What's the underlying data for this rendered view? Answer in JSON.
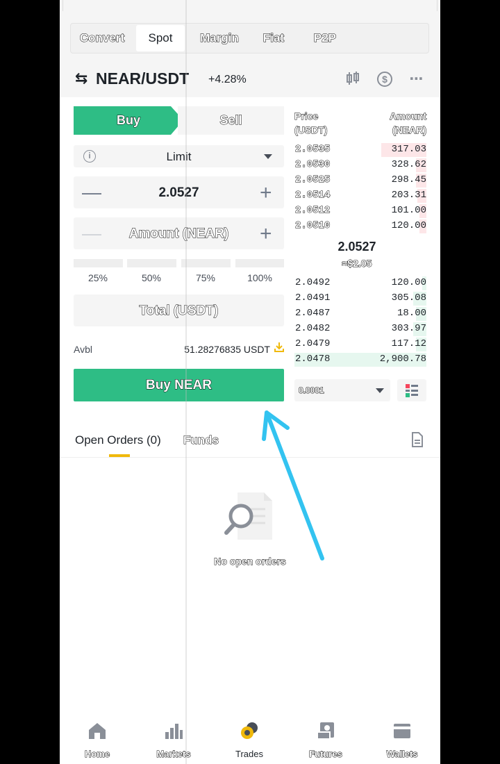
{
  "header": {
    "tabs": [
      {
        "label": "Convert",
        "active": false
      },
      {
        "label": "Spot",
        "active": true
      },
      {
        "label": "Margin",
        "active": false
      },
      {
        "label": "Fiat",
        "active": false
      },
      {
        "label": "P2P",
        "active": false
      }
    ],
    "pair": "NEAR/USDT",
    "change": "+4.28%"
  },
  "order_form": {
    "buy_label": "Buy",
    "sell_label": "Sell",
    "order_type": "Limit",
    "price_value": "2.0527",
    "amount_placeholder": "Amount (NEAR)",
    "percentages": [
      "25%",
      "50%",
      "75%",
      "100%"
    ],
    "total_placeholder": "Total (USDT)",
    "avbl_label": "Avbl",
    "avbl_value": "51.28276835 USDT",
    "submit_label": "Buy NEAR"
  },
  "orderbook": {
    "price_header": "Price\n(USDT)",
    "amount_header": "Amount\n(NEAR)",
    "asks": [
      {
        "price": "2.0535",
        "amount": "317.03",
        "depth": 0.34
      },
      {
        "price": "2.0530",
        "amount": "328.62",
        "depth": 0.08
      },
      {
        "price": "2.0525",
        "amount": "298.45",
        "depth": 0.08
      },
      {
        "price": "2.0514",
        "amount": "203.31",
        "depth": 0.07
      },
      {
        "price": "2.0512",
        "amount": "101.00",
        "depth": 0.05
      },
      {
        "price": "2.0510",
        "amount": "120.00",
        "depth": 0.05
      }
    ],
    "last_price": "2.0527",
    "last_price_usd": "≈$2.05",
    "bids": [
      {
        "price": "2.0492",
        "amount": "120.00",
        "depth": 0.03
      },
      {
        "price": "2.0491",
        "amount": "305.08",
        "depth": 0.1
      },
      {
        "price": "2.0487",
        "amount": "18.00",
        "depth": 0.08
      },
      {
        "price": "2.0482",
        "amount": "303.97",
        "depth": 0.1
      },
      {
        "price": "2.0479",
        "amount": "117.12",
        "depth": 0.08
      },
      {
        "price": "2.0478",
        "amount": "2,900.78",
        "depth": 1.0
      }
    ],
    "precision": "0.0001"
  },
  "orders": {
    "tab_open": "Open Orders (0)",
    "tab_funds": "Funds",
    "empty_text": "No open orders"
  },
  "bottom_nav": [
    {
      "label": "Home",
      "icon": "home-icon"
    },
    {
      "label": "Markets",
      "icon": "markets-icon"
    },
    {
      "label": "Trades",
      "icon": "trades-icon",
      "active": true
    },
    {
      "label": "Futures",
      "icon": "futures-icon"
    },
    {
      "label": "Wallets",
      "icon": "wallets-icon"
    }
  ],
  "colors": {
    "buy_green": "#2ebd85",
    "ask_bg": "#fde6e8",
    "bid_bg": "#e6f7ef",
    "accent_yellow": "#f0b90b",
    "annotation_arrow": "#33c3f0"
  }
}
